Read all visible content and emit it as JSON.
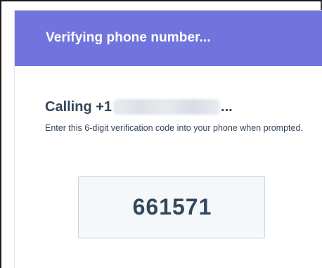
{
  "header": {
    "title": "Verifying phone number..."
  },
  "calling": {
    "prefix": "Calling +1",
    "suffix": "..."
  },
  "instructions": {
    "text": "Enter this 6-digit verification code into your phone when prompted."
  },
  "verification": {
    "code": "661571"
  },
  "colors": {
    "header_bg": "#7174dc",
    "text": "#33475b",
    "code_box_bg": "#f5f8fa",
    "code_box_border": "#cbd6e2"
  }
}
